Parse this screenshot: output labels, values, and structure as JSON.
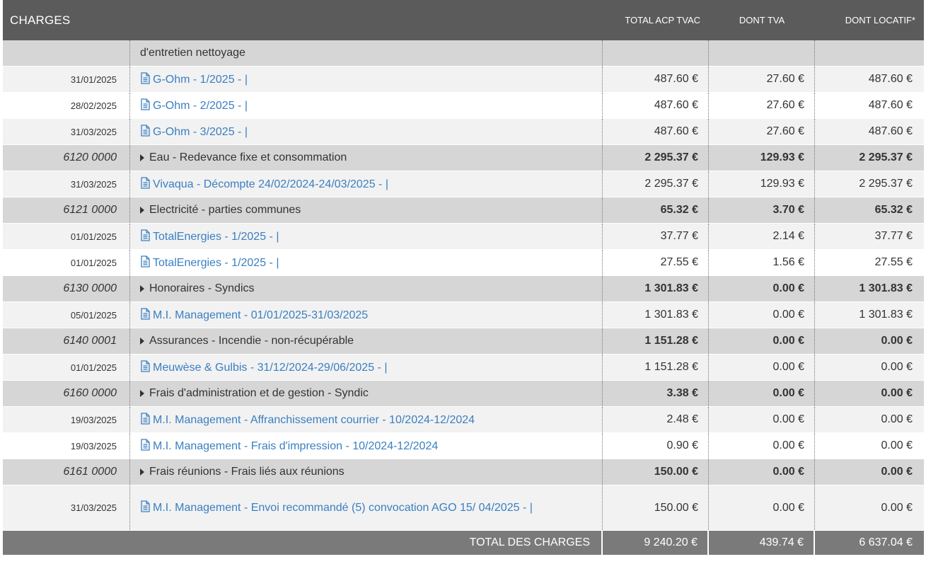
{
  "header": {
    "title": "CHARGES",
    "col_total": "TOTAL ACP TVAC",
    "col_tva": "DONT TVA",
    "col_locatif": "DONT LOCATIF*"
  },
  "top_row": {
    "label": "d'entretien nettoyage"
  },
  "rows": [
    {
      "type": "line",
      "date": "31/01/2025",
      "desc": "G-Ohm - 1/2025 - |",
      "total": "487.60 €",
      "tva": "27.60 €",
      "loc": "487.60 €"
    },
    {
      "type": "line",
      "date": "28/02/2025",
      "desc": "G-Ohm - 2/2025 - |",
      "total": "487.60 €",
      "tva": "27.60 €",
      "loc": "487.60 €"
    },
    {
      "type": "line",
      "date": "31/03/2025",
      "desc": "G-Ohm - 3/2025 - |",
      "total": "487.60 €",
      "tva": "27.60 €",
      "loc": "487.60 €"
    },
    {
      "type": "group",
      "code": "6120 0000",
      "desc": "Eau - Redevance fixe et consommation",
      "total": "2 295.37 €",
      "tva": "129.93 €",
      "loc": "2 295.37 €"
    },
    {
      "type": "line",
      "date": "31/03/2025",
      "desc": "Vivaqua - Décompte 24/02/2024-24/03/2025 - |",
      "total": "2 295.37 €",
      "tva": "129.93 €",
      "loc": "2 295.37 €"
    },
    {
      "type": "group",
      "code": "6121 0000",
      "desc": "Electricité - parties communes",
      "total": "65.32 €",
      "tva": "3.70 €",
      "loc": "65.32 €"
    },
    {
      "type": "line",
      "date": "01/01/2025",
      "desc": "TotalEnergies - 1/2025 - |",
      "total": "37.77 €",
      "tva": "2.14 €",
      "loc": "37.77 €"
    },
    {
      "type": "line",
      "date": "01/01/2025",
      "desc": "TotalEnergies - 1/2025 - |",
      "total": "27.55 €",
      "tva": "1.56 €",
      "loc": "27.55 €"
    },
    {
      "type": "group",
      "code": "6130 0000",
      "desc": "Honoraires - Syndics",
      "total": "1 301.83 €",
      "tva": "0.00 €",
      "loc": "1 301.83 €"
    },
    {
      "type": "line",
      "date": "05/01/2025",
      "desc": "M.I. Management - 01/01/2025-31/03/2025",
      "total": "1 301.83 €",
      "tva": "0.00 €",
      "loc": "1 301.83 €"
    },
    {
      "type": "group",
      "code": "6140 0001",
      "desc": "Assurances - Incendie - non-récupérable",
      "total": "1 151.28 €",
      "tva": "0.00 €",
      "loc": "0.00 €"
    },
    {
      "type": "line",
      "date": "01/01/2025",
      "desc": "Meuwèse & Gulbis - 31/12/2024-29/06/2025 - |",
      "total": "1 151.28 €",
      "tva": "0.00 €",
      "loc": "0.00 €"
    },
    {
      "type": "group",
      "code": "6160 0000",
      "desc": "Frais d'administration et de gestion - Syndic",
      "total": "3.38 €",
      "tva": "0.00 €",
      "loc": "0.00 €"
    },
    {
      "type": "line",
      "date": "19/03/2025",
      "desc": "M.I. Management - Affranchissement courrier - 10/2024-12/2024",
      "total": "2.48 €",
      "tva": "0.00 €",
      "loc": "0.00 €"
    },
    {
      "type": "line",
      "date": "19/03/2025",
      "desc": "M.I. Management - Frais d'impression - 10/2024-12/2024",
      "total": "0.90 €",
      "tva": "0.00 €",
      "loc": "0.00 €"
    },
    {
      "type": "group",
      "code": "6161 0000",
      "desc": "Frais réunions - Frais liés aux réunions",
      "total": "150.00 €",
      "tva": "0.00 €",
      "loc": "0.00 €"
    },
    {
      "type": "tall",
      "date": "31/03/2025",
      "desc": "M.I. Management - Envoi recommandé (5) convocation AGO 15/ 04/2025 - |",
      "total": "150.00 €",
      "tva": "0.00 €",
      "loc": "0.00 €"
    }
  ],
  "total_row": {
    "label": "TOTAL DES CHARGES",
    "total": "9 240.20 €",
    "tva": "439.74 €",
    "loc": "6 637.04 €"
  },
  "colors": {
    "header_bg": "#5b5b5b",
    "group_bg": "#d6d6d6",
    "link": "#3a7fc1",
    "total_bg": "#7a7a7a"
  },
  "icons": {
    "doc": "document-icon",
    "caret": "caret-right-icon"
  }
}
